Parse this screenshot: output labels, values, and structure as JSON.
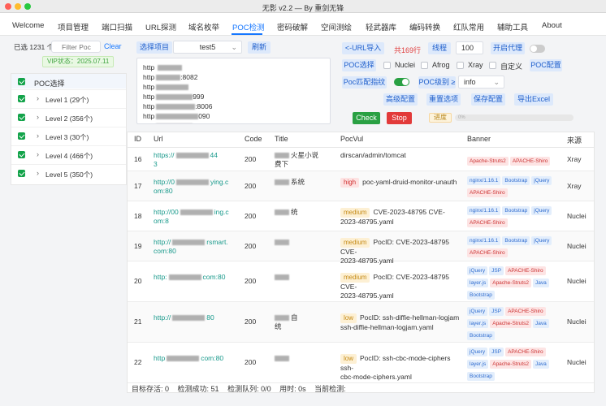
{
  "window": {
    "title": "无影 v2.2 — By 重剑无锋"
  },
  "tabs": [
    "Welcome",
    "项目管理",
    "端口扫描",
    "URL探测",
    "域名枚举",
    "POC检测",
    "密码破解",
    "空间测绘",
    "轻武器库",
    "编码转换",
    "红队常用",
    "辅助工具",
    "About"
  ],
  "active_tab": "POC检测",
  "left": {
    "selected_count": "已选 1231 个",
    "filter_placeholder": "Filter Poc",
    "clear_label": "Clear",
    "vip_status": "VIP状态：2025.07.11",
    "tree_header": "POC选择",
    "levels": [
      "Level 1 (29个)",
      "Level 2 (356个)",
      "Level 3 (30个)",
      "Level 4 (466个)",
      "Level 5 (350个)"
    ]
  },
  "toolbar": {
    "select_project": "选择项目",
    "project_value": "test5",
    "refresh": "刷新",
    "url_import": "<-URL导入",
    "total_lines": "共169行",
    "threads_label": "线程",
    "threads_value": "100",
    "proxy_label": "开启代理",
    "poc_select": "POC选择",
    "nuclei": "Nuclei",
    "afrog": "Afrog",
    "xray": "Xray",
    "custom": "自定义",
    "poc_config": "POC配置",
    "poc_fingerprint": "Poc匹配指纹",
    "poc_level_label": "POC级别 ≥",
    "poc_level_value": "info",
    "advanced_config": "高级配置",
    "reset_options": "重置选项",
    "save_config": "保存配置",
    "export_excel": "导出Excel",
    "check": "Check",
    "stop": "Stop",
    "progress_label": "进度",
    "progress_value": "0%"
  },
  "urls_preview": [
    "http",
    "http",
    "http",
    "http",
    "http",
    "http",
    "http"
  ],
  "url_suffixes": [
    "",
    ":8082",
    "",
    "999",
    ":8006",
    "090",
    ""
  ],
  "table": {
    "headers": [
      "ID",
      "Url",
      "Code",
      "Title",
      "PocVul",
      "Banner",
      "来源"
    ],
    "rows": [
      {
        "id": "16",
        "url1": "https://",
        "url2": "44",
        "url3": "3",
        "code": "200",
        "title1": "火星小说",
        "title2": "费下",
        "sev": "",
        "vul": "dirscan/admin/tomcat",
        "vul2": "",
        "tags": [
          [
            "Apache-Struts2",
            "red"
          ],
          [
            "APACHE-Shiro",
            "red"
          ]
        ],
        "src": "Xray"
      },
      {
        "id": "17",
        "url1": "http://0",
        "url2": "ying.c",
        "url3": "om:80",
        "code": "200",
        "title1": "系统",
        "title2": "",
        "sev": "high",
        "vul": "poc-yaml-druid-monitor-unauth",
        "vul2": "",
        "tags": [
          [
            "nginx/1.16.1",
            "blue"
          ],
          [
            "Bootstrap",
            "blue"
          ],
          [
            "jQuery",
            "blue"
          ],
          [
            "APACHE-Shiro",
            "red"
          ]
        ],
        "src": "Xray"
      },
      {
        "id": "18",
        "url1": "http://00",
        "url2": "ing.c",
        "url3": "om:8",
        "code": "200",
        "title1": "统",
        "title2": "",
        "sev": "medium",
        "vul": "CVE-2023-48795 CVE-",
        "vul2": "2023-48795.yaml",
        "tags": [
          [
            "nginx/1.16.1",
            "blue"
          ],
          [
            "Bootstrap",
            "blue"
          ],
          [
            "jQuery",
            "blue"
          ],
          [
            "APACHE-Shiro",
            "red"
          ]
        ],
        "src": "Nuclei"
      },
      {
        "id": "19",
        "url1": "http://",
        "url2": "rsmart.",
        "url3": "com:80",
        "code": "200",
        "title1": "",
        "title2": "",
        "sev": "medium",
        "vul": "PocID: CVE-2023-48795 CVE-",
        "vul2": "2023-48795.yaml",
        "tags": [
          [
            "nginx/1.16.1",
            "blue"
          ],
          [
            "Bootstrap",
            "blue"
          ],
          [
            "jQuery",
            "blue"
          ],
          [
            "APACHE-Shiro",
            "red"
          ]
        ],
        "src": "Nuclei"
      },
      {
        "id": "20",
        "url1": "http:",
        "url2": "com:80",
        "url3": "",
        "code": "200",
        "title1": "",
        "title2": "",
        "sev": "medium",
        "vul": "PocID: CVE-2023-48795 CVE-",
        "vul2": "2023-48795.yaml",
        "tags": [
          [
            "jQuery",
            "blue"
          ],
          [
            "JSP",
            "blue"
          ],
          [
            "APACHE-Shiro",
            "red"
          ],
          [
            "layer.js",
            "blue"
          ],
          [
            "Apache-Struts2",
            "red"
          ],
          [
            "Java",
            "blue"
          ],
          [
            "Bootstrap",
            "blue"
          ]
        ],
        "src": "Nuclei"
      },
      {
        "id": "21",
        "url1": "http://",
        "url2": "80",
        "url3": "",
        "code": "200",
        "title1": "自",
        "title2": "统",
        "sev": "low",
        "vul": "PocID: ssh-diffie-hellman-logjam",
        "vul2": "ssh-diffie-hellman-logjam.yaml",
        "tags": [
          [
            "jQuery",
            "blue"
          ],
          [
            "JSP",
            "blue"
          ],
          [
            "APACHE-Shiro",
            "red"
          ],
          [
            "layer.js",
            "blue"
          ],
          [
            "Apache-Struts2",
            "red"
          ],
          [
            "Java",
            "blue"
          ],
          [
            "Bootstrap",
            "blue"
          ]
        ],
        "src": "Nuclei"
      },
      {
        "id": "22",
        "url1": "http",
        "url2": "com:80",
        "url3": "",
        "code": "200",
        "title1": "",
        "title2": "",
        "sev": "low",
        "vul": "PocID: ssh-cbc-mode-ciphers ssh-",
        "vul2": "cbc-mode-ciphers.yaml",
        "tags": [
          [
            "jQuery",
            "blue"
          ],
          [
            "JSP",
            "blue"
          ],
          [
            "APACHE-Shiro",
            "red"
          ],
          [
            "layer.js",
            "blue"
          ],
          [
            "Apache-Struts2",
            "red"
          ],
          [
            "Java",
            "blue"
          ],
          [
            "Bootstrap",
            "blue"
          ]
        ],
        "src": "Nuclei"
      }
    ]
  },
  "status": {
    "alive": "目标存活: 0",
    "success": "检测成功: 51",
    "queue": "检测队列: 0/0",
    "time": "用时: 0s",
    "current": "当前检测:"
  }
}
